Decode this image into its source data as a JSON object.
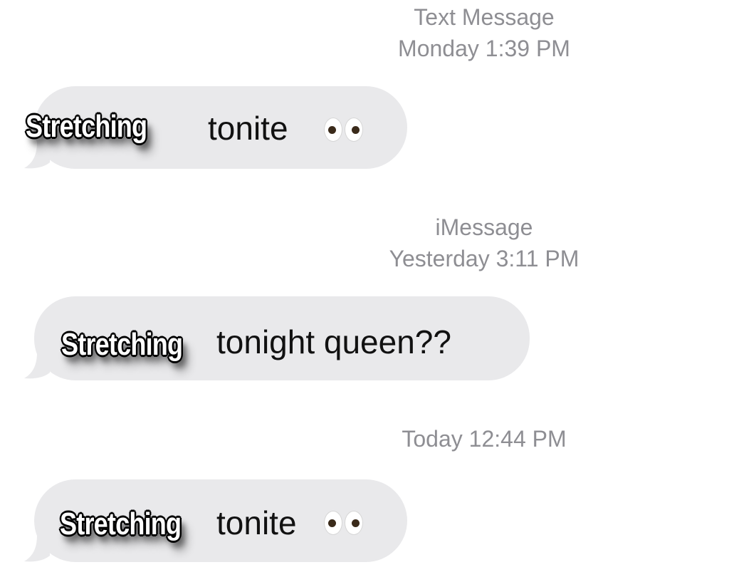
{
  "thread": {
    "group1": {
      "service": "Text Message",
      "timestamp": "Monday 1:39 PM",
      "message_text": "tonite",
      "emoji": "eyes-emoji",
      "overlay_caption": "Stretching"
    },
    "group2": {
      "service": "iMessage",
      "timestamp": "Yesterday 3:11 PM",
      "message_text": "tonight queen??",
      "overlay_caption": "Stretching"
    },
    "group3": {
      "timestamp": "Today 12:44 PM",
      "message_text": "tonite",
      "emoji": "eyes-emoji",
      "overlay_caption": "Stretching"
    }
  },
  "colors": {
    "bubble_received": "#e9e9eb",
    "meta_text": "#8e8e93",
    "background": "#ffffff"
  }
}
